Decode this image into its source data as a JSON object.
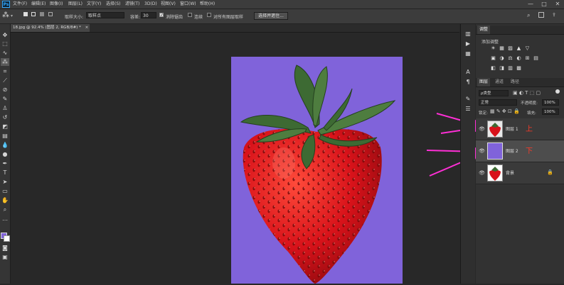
{
  "app": {
    "logo": "Ps"
  },
  "menu": [
    "文件(F)",
    "编辑(E)",
    "图像(I)",
    "图层(L)",
    "文字(Y)",
    "选择(S)",
    "滤镜(T)",
    "3D(D)",
    "视图(V)",
    "窗口(W)",
    "帮助(H)"
  ],
  "window_controls": {
    "minimize": "—",
    "maximize": "□",
    "close": "✕"
  },
  "options": {
    "sample_size_label": "取样大小:",
    "sample_size_value": "取样点",
    "tolerance_label": "容差:",
    "tolerance_value": "30",
    "anti_alias_label": "消除锯齿",
    "contiguous_label": "连续",
    "sample_all_label": "对所有图层取样",
    "select_subject_label": "选择并遮住..."
  },
  "document": {
    "tab_title": "18.jpg @ 92.4% (图层 2, RGB/8#) *",
    "close": "×",
    "bg_color": "#8063da"
  },
  "panels": {
    "adjustments_tab": "调整",
    "adjustments_title": "添加调整",
    "adjust_icons_row1": [
      "☀",
      "▦",
      "▨",
      "▲",
      "▽"
    ],
    "adjust_icons_row2": [
      "▣",
      "◑",
      "⚖",
      "◐",
      "⊞",
      "▤"
    ],
    "adjust_icons_row3": [
      "◧",
      "◨",
      "▥",
      "▩"
    ],
    "layers_tabs": [
      "图层",
      "通道",
      "路径"
    ],
    "filter_kind": "ρ类型",
    "blend_mode": "正常",
    "opacity_label": "不透明度:",
    "opacity_value": "100%",
    "lock_label": "锁定:",
    "fill_label": "填充:",
    "fill_value": "100%"
  },
  "layers": [
    {
      "name": "图层 1",
      "annotation": "上",
      "visible": true,
      "selected": false
    },
    {
      "name": "图层 2",
      "annotation": "下",
      "visible": true,
      "selected": true,
      "color": "#8063da"
    },
    {
      "name": "背景",
      "visible": true,
      "selected": false,
      "locked": true
    }
  ],
  "colors": {
    "accent": "#31a8ff",
    "arrow": "#ff2fd6",
    "annotation": "#ff3a28",
    "strawberry": "#d8121a"
  }
}
